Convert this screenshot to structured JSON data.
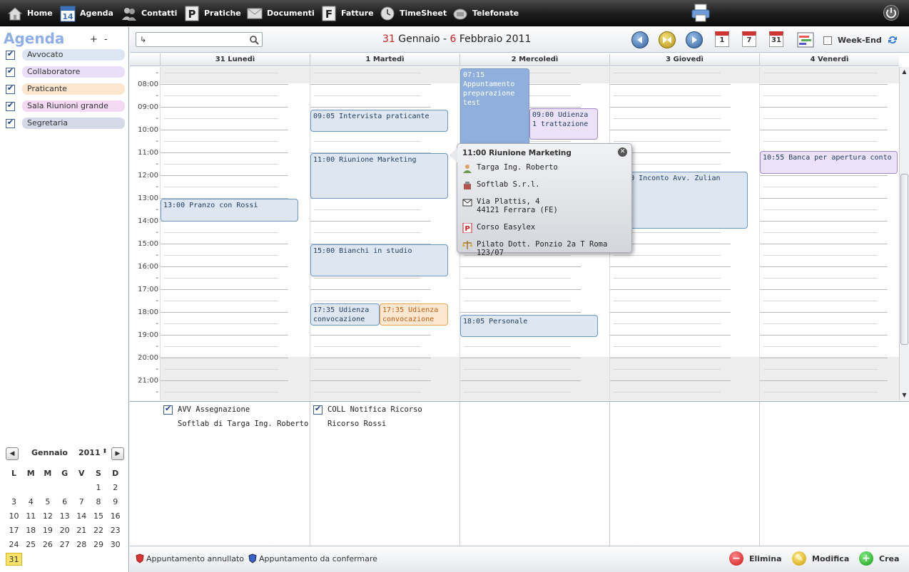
{
  "nav": {
    "items": [
      {
        "label": "Home",
        "icon": "home-icon"
      },
      {
        "label": "Agenda",
        "icon": "calendar-icon"
      },
      {
        "label": "Contatti",
        "icon": "contacts-icon"
      },
      {
        "label": "Pratiche",
        "icon": "pratiche-icon"
      },
      {
        "label": "Documenti",
        "icon": "documents-icon"
      },
      {
        "label": "Fatture",
        "icon": "invoices-icon"
      },
      {
        "label": "TimeSheet",
        "icon": "clock-icon"
      },
      {
        "label": "Telefonate",
        "icon": "phone-icon"
      }
    ]
  },
  "sidebar": {
    "title": "Agenda",
    "plus": "+",
    "minus": "-",
    "calendars": [
      {
        "label": "Avvocato",
        "color": "#dce6f2"
      },
      {
        "label": "Collaboratore",
        "color": "#eadff8"
      },
      {
        "label": "Praticante",
        "color": "#fde6cf"
      },
      {
        "label": "Sala Riunioni grande",
        "color": "#f3d9f1"
      },
      {
        "label": "Segretaria",
        "color": "#d6d9e8"
      }
    ]
  },
  "minical": {
    "month": "Gennaio",
    "year": "2011",
    "weekdays": [
      "L",
      "M",
      "M",
      "G",
      "V",
      "S",
      "D"
    ],
    "weeks": [
      [
        "",
        "",
        "",
        "",
        "",
        "1",
        "2"
      ],
      [
        "3",
        "4",
        "5",
        "6",
        "7",
        "8",
        "9"
      ],
      [
        "10",
        "11",
        "12",
        "13",
        "14",
        "15",
        "16"
      ],
      [
        "17",
        "18",
        "19",
        "20",
        "21",
        "22",
        "23"
      ],
      [
        "24",
        "25",
        "26",
        "27",
        "28",
        "29",
        "30"
      ],
      [
        "31",
        "",
        "",
        "",
        "",
        "",
        ""
      ]
    ],
    "today": "31"
  },
  "toolbar": {
    "range_start_day": "31",
    "range_start_month": " Gennaio - ",
    "range_end_day": "6",
    "range_end_rest": " Febbraio 2011",
    "cal_day": "1",
    "cal_week": "7",
    "cal_month": "31",
    "weekend_label": "Week-End"
  },
  "days": [
    "31 Lunedì",
    "1 Martedì",
    "2 Mercoledì",
    "3 Giovedì",
    "4 Venerdì"
  ],
  "hours": [
    "-",
    "08:00",
    "-",
    "09:00",
    "-",
    "10:00",
    "-",
    "11:00",
    "-",
    "12:00",
    "-",
    "13:00",
    "-",
    "14:00",
    "-",
    "15:00",
    "-",
    "16:00",
    "-",
    "17:00",
    "-",
    "18:00",
    "-",
    "19:00",
    "-",
    "20:00",
    "-",
    "21:00",
    "-"
  ],
  "events": [
    {
      "text": "13:00 Pranzo con Rossi"
    },
    {
      "text": "09:05 Intervista praticante"
    },
    {
      "text": "11:00 Riunione Marketing"
    },
    {
      "text": "15:00 Bianchi in studio"
    },
    {
      "text": "17:35 Udienza convocazione"
    },
    {
      "text": "17:35 Udienza convocazione"
    },
    {
      "text": "07:15 Appuntamento preparazione test"
    },
    {
      "text": "09:00 Udienza 1 trattazione"
    },
    {
      "text": "18:05 Personale"
    },
    {
      "text": "11:30 Inconto Avv. Zulian"
    },
    {
      "text": "10:55 Banca per apertura conto"
    }
  ],
  "popup": {
    "title": "11:00 Riunione Marketing",
    "contact": "Targa Ing. Roberto",
    "company": "Softlab S.r.l.",
    "address1": "Via Plattis, 4",
    "address2": "44121 Ferrara (FE)",
    "pratica": "Corso Easylex",
    "court": "Pilato Dott. Ponzio 2a T Roma 123/07"
  },
  "allday": [
    {
      "title": "AVV Assegnazione",
      "detail": "Softlab di Targa Ing. Roberto e C"
    },
    {
      "title": "COLL Notifica Ricorso",
      "detail": "Ricorso Rossi"
    }
  ],
  "footer": {
    "legend_cancelled": "Appuntamento annullato",
    "legend_to_confirm": "Appuntamento da confermare",
    "delete": "Elimina",
    "edit": "Modifica",
    "create": "Crea"
  }
}
